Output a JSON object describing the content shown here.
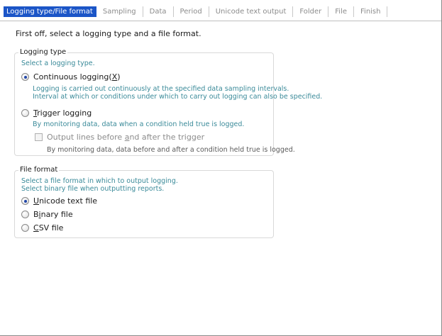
{
  "tabs": [
    {
      "label": "Logging type/File format",
      "active": true
    },
    {
      "label": "Sampling",
      "active": false
    },
    {
      "label": "Data",
      "active": false
    },
    {
      "label": "Period",
      "active": false
    },
    {
      "label": "Unicode text output",
      "active": false
    },
    {
      "label": "Folder",
      "active": false
    },
    {
      "label": "File",
      "active": false
    },
    {
      "label": "Finish",
      "active": false
    }
  ],
  "intro": "First off, select a logging type and a file format.",
  "logging_type": {
    "title": "Logging type",
    "hint": "Select a logging type.",
    "continuous": {
      "label_pre": "Continuous logging(",
      "label_key": "X",
      "label_post": ")",
      "checked": true,
      "desc_line1": "Logging is carried out continuously at the specified data sampling intervals.",
      "desc_line2": "Interval at which or conditions under which to carry out logging can also be specified."
    },
    "trigger": {
      "label_key": "T",
      "label_post": "rigger logging",
      "checked": false,
      "desc": "By monitoring data, data when a condition held true is logged."
    },
    "output_lines": {
      "label_pre": "Output lines before ",
      "label_key": "a",
      "label_post": "nd after the trigger",
      "checked": false,
      "enabled": false,
      "desc": "By monitoring data, data before and after a condition held true is logged."
    }
  },
  "file_format": {
    "title": "File format",
    "hint_line1": "Select a file format in which to output logging.",
    "hint_line2": "Select binary file when outputting reports.",
    "options": [
      {
        "key": "U",
        "post": "nicode text file",
        "pre": "",
        "checked": true
      },
      {
        "key": "i",
        "post": "nary file",
        "pre": "B",
        "checked": false
      },
      {
        "key": "C",
        "post": "SV file",
        "pre": "",
        "checked": false
      }
    ]
  },
  "colors": {
    "active_tab": "#1b55c7",
    "hint_text": "#3a8a99",
    "radio_dot": "#2247a8"
  }
}
